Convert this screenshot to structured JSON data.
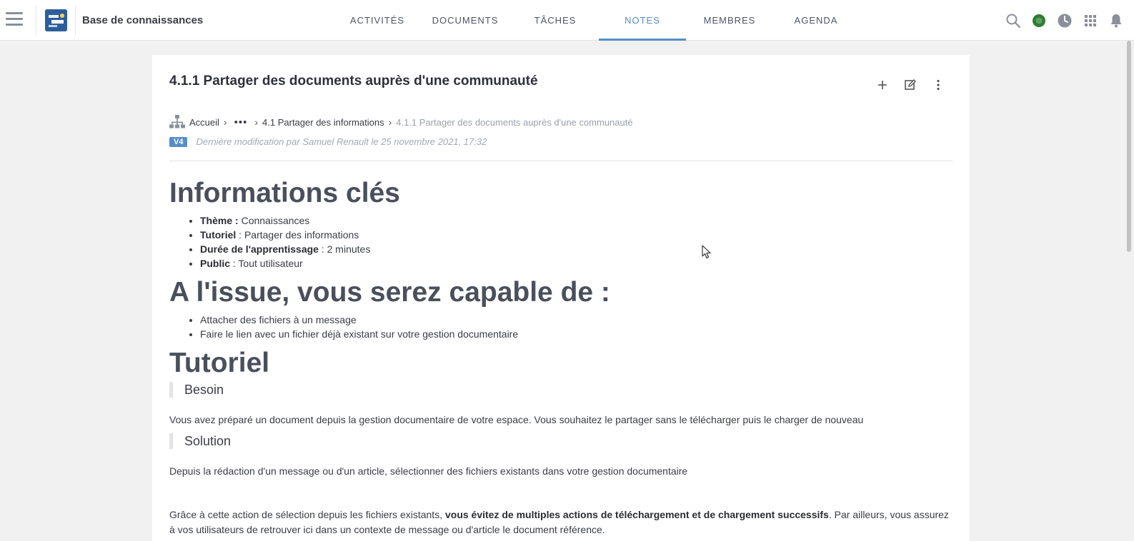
{
  "header": {
    "space_name": "Base de connaissances",
    "tabs": [
      {
        "label": "ACTIVITÉS",
        "active": false
      },
      {
        "label": "DOCUMENTS",
        "active": false
      },
      {
        "label": "TÂCHES",
        "active": false
      },
      {
        "label": "NOTES",
        "active": true
      },
      {
        "label": "MEMBRES",
        "active": false
      },
      {
        "label": "AGENDA",
        "active": false
      }
    ],
    "icons": [
      "search-icon",
      "chat-icon",
      "clock-icon",
      "apps-grid-icon",
      "bell-icon"
    ],
    "accent_color": "#578dc9"
  },
  "note": {
    "title": "4.1.1 Partager des documents auprès d'une communauté",
    "breadcrumb": {
      "home": "Accueil",
      "more": "•••",
      "parent": "4.1 Partager des informations",
      "current": "4.1.1 Partager des documents auprès d'une communauté"
    },
    "version": "V4",
    "last_modified": "Dernière modification par Samuel Renault le 25 novembre 2021, 17:32"
  },
  "content": {
    "h_key_info": "Informations clés",
    "key_info": [
      {
        "label": "Thème :",
        "value": " Connaissances"
      },
      {
        "label": "Tutoriel",
        "value": " : Partager des informations"
      },
      {
        "label": "Durée de l'apprentissage",
        "value": " : 2 minutes"
      },
      {
        "label": "Public",
        "value": " : Tout utilisateur"
      }
    ],
    "h_outcome": "A l'issue, vous serez capable de :",
    "outcomes": [
      "Attacher des fichiers à un message",
      "Faire le lien avec un fichier déjà existant sur votre gestion documentaire"
    ],
    "h_tutorial": "Tutoriel",
    "q_need": "Besoin",
    "p_need": "Vous avez préparé un document depuis la gestion documentaire de votre espace. Vous souhaitez le partager sans le télécharger puis le charger de nouveau",
    "q_solution": "Solution",
    "p_solution": "Depuis la rédaction d'un message ou d'un article, sélectionner des fichiers existants dans votre gestion documentaire",
    "p_benefit_1a": "Grâce à cette action de sélection depuis les fichiers existants, ",
    "p_benefit_1b": "vous évitez de multiples actions de téléchargement et de chargement successifs",
    "p_benefit_1c": ". Par ailleurs, vous assurez",
    "p_benefit_2": "à vos utilisateurs de retrouver ici dans un contexte de message ou d'article le document référence."
  }
}
